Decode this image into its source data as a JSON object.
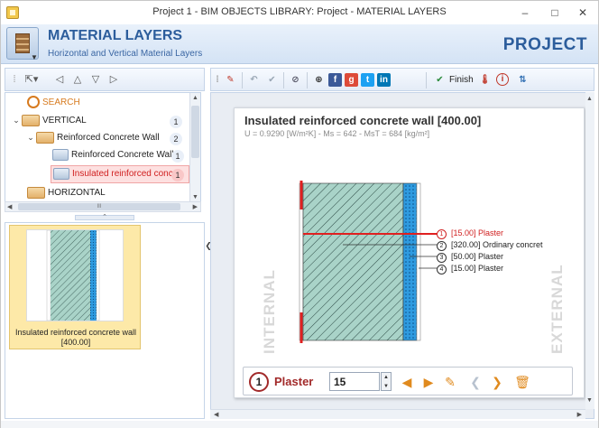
{
  "window": {
    "title": "Project 1 -  BIM OBJECTS LIBRARY: Project - MATERIAL LAYERS",
    "minimize": "–",
    "restore": "□",
    "close": "✕"
  },
  "banner": {
    "title": "MATERIAL LAYERS",
    "subtitle": "Horizontal and Vertical Material Layers",
    "right_label": "PROJECT"
  },
  "left_toolbar": {
    "icons": [
      "cursor-icon",
      "nav-first-icon",
      "nav-up-icon",
      "nav-down-icon",
      "nav-last-icon"
    ]
  },
  "tree": {
    "search_label": "SEARCH",
    "items": [
      {
        "label": "VERTICAL",
        "count": "1"
      },
      {
        "label": "Reinforced Concrete Wall",
        "count": "2"
      },
      {
        "label": "Reinforced Concrete Wall",
        "count": "1"
      },
      {
        "label": "Insulated reinforced conc",
        "count": "1"
      },
      {
        "label": "HORIZONTAL",
        "count": ""
      }
    ],
    "hscroll_label": "III"
  },
  "thumbnail": {
    "label_line1": "Insulated reinforced concrete wall",
    "label_line2": "[400.00]"
  },
  "right_toolbar": {
    "finish_label": "Finish",
    "icons": [
      "edit-icon",
      "undo-icon",
      "check-icon",
      "attach-icon",
      "share-icon",
      "facebook-icon",
      "google-plus-icon",
      "twitter-icon",
      "linkedin-icon",
      "finish-icon",
      "thermometer-icon",
      "info-icon",
      "layers-icon"
    ]
  },
  "sheet": {
    "title": "Insulated reinforced concrete wall [400.00]",
    "subtitle": "U = 0.9290 [W/m²K] - Ms = 642 - MsT = 684 [kg/m²]",
    "internal_label": "INTERNAL",
    "external_label": "EXTERNAL",
    "layers": [
      {
        "num": "1",
        "text": "[15.00]  Plaster",
        "color": "#d02020"
      },
      {
        "num": "2",
        "text": "[320.00]  Ordinary concret",
        "color": "#222222"
      },
      {
        "num": "3",
        "text": "[50.00]  Plaster",
        "color": "#222222"
      },
      {
        "num": "4",
        "text": "[15.00]  Plaster",
        "color": "#222222"
      }
    ]
  },
  "edit_bar": {
    "layer_number": "1",
    "layer_name": "Plaster",
    "thickness_value": "15"
  },
  "colors": {
    "accent": "#2c5d9c",
    "selected_layer": "#d02020",
    "concrete": "#9fc9be",
    "insulation": "#3aa0e0"
  }
}
